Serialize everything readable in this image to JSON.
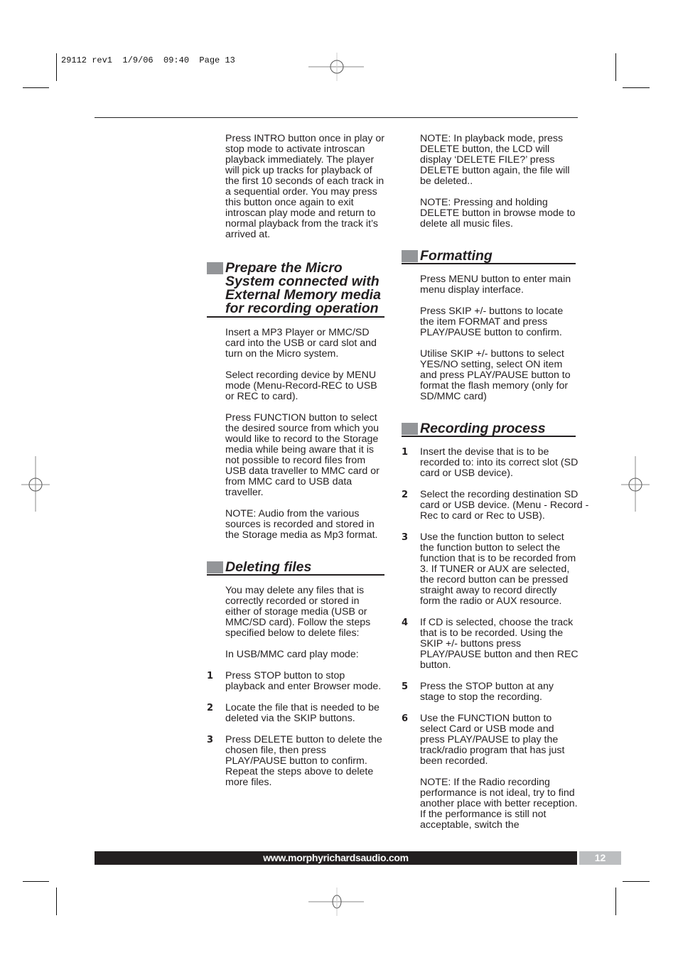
{
  "print_slug": "29112 rev1  1/9/06  09:40  Page 13",
  "left_column": {
    "intro_paragraph": "Press INTRO button once in play or stop mode to activate introscan playback immediately. The player will pick up tracks for playback of the first 10 seconds of each track in a sequential order. You may press this button once again to exit introscan play mode and return to normal playback from the track it’s arrived at.",
    "prepare_section": {
      "heading": "Prepare the Micro System connected with External Memory media for recording operation",
      "paragraphs": [
        "Insert a MP3 Player or MMC/SD card into the USB or card slot and turn on the Micro system.",
        "Select recording device by MENU mode (Menu-Record-REC to USB or REC to card).",
        "Press FUNCTION button to select the desired source from which you would like to record to the Storage media  while being aware that it is not possible to record files from USB data traveller to MMC card or from MMC card to USB data traveller.",
        "NOTE: Audio from the various sources is recorded and stored in the Storage media as Mp3 format."
      ]
    },
    "deleting_section": {
      "heading": "Deleting files",
      "paragraphs": [
        "You may delete any files that is correctly recorded or stored in either of storage media (USB or MMC/SD card). Follow  the steps specified below to delete files:",
        "In USB/MMC card play mode:"
      ],
      "steps": [
        {
          "num": "1",
          "text": "Press STOP button to stop playback and enter Browser mode."
        },
        {
          "num": "2",
          "text": "Locate the file that is needed to be deleted via the  SKIP buttons."
        },
        {
          "num": "3",
          "text": "Press DELETE button to delete the chosen file, then press PLAY/PAUSE button to confirm. Repeat the steps above to delete more files."
        }
      ]
    }
  },
  "right_column": {
    "notes": [
      "NOTE: In playback mode, press DELETE button, the LCD will display ‘DELETE FILE?’ press DELETE button again, the file will be deleted..",
      "NOTE: Pressing and holding DELETE button in browse mode to delete all music files."
    ],
    "formatting_section": {
      "heading": "Formatting",
      "paragraphs": [
        "Press MENU button to enter main menu display interface.",
        "Press SKIP +/- buttons to locate the item FORMAT and press PLAY/PAUSE button to confirm.",
        "Utilise SKIP +/- buttons to select YES/NO setting, select ON item and press PLAY/PAUSE button to format the flash memory (only for SD/MMC card)"
      ]
    },
    "recording_section": {
      "heading": "Recording process",
      "steps": [
        {
          "num": "1",
          "text": "Insert the devise that is to be recorded to: into its correct slot (SD card or USB device)."
        },
        {
          "num": "2",
          "text": "Select the recording destination SD card or USB device. (Menu - Record - Rec to card  or Rec to USB)."
        },
        {
          "num": "3",
          "text": "Use the function button to select the function button to select the function that is to be recorded from 3. If TUNER or AUX are selected, the record button can be pressed straight away to record directly form the radio or AUX resource."
        },
        {
          "num": "4",
          "text": "If CD is selected, choose the track that is to be recorded. Using the SKIP +/- buttons press PLAY/PAUSE button and then REC button."
        },
        {
          "num": "5",
          "text": "Press the STOP button at any stage to stop the recording."
        },
        {
          "num": "6",
          "text": "Use the FUNCTION button to select Card or USB mode and press PLAY/PAUSE to play the track/radio program that has just been recorded."
        }
      ],
      "note": "NOTE: If the Radio recording performance is not ideal, try to find another place with better reception. If the performance is still not acceptable, switch the"
    }
  },
  "footer": {
    "url": "www.morphyrichardsaudio.com",
    "page_number": "12",
    "bar_color": "#231f20",
    "page_box_color": "#bcbec0"
  },
  "colors": {
    "heading_square": "#939598",
    "text": "#231f20"
  }
}
